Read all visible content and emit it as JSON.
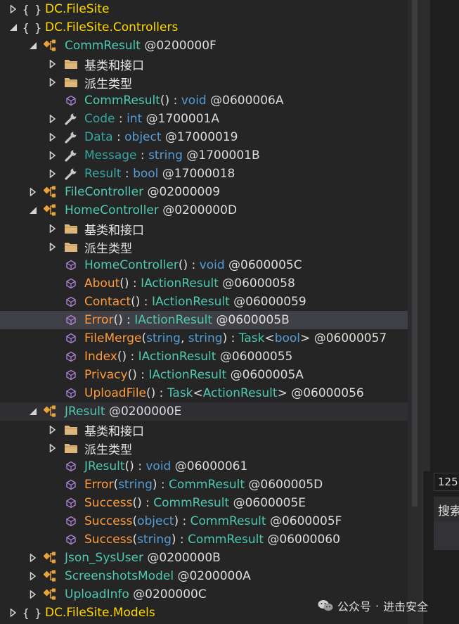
{
  "tree": {
    "rows": [
      {
        "indent": 0,
        "expander": "collapsed",
        "icon": "namespace",
        "parts": [
          {
            "t": "DC.FileSite",
            "c": "ns"
          }
        ]
      },
      {
        "indent": 0,
        "expander": "expanded",
        "icon": "namespace",
        "parts": [
          {
            "t": "DC.FileSite.Controllers",
            "c": "ns"
          }
        ]
      },
      {
        "indent": 1,
        "expander": "expanded",
        "icon": "class",
        "parts": [
          {
            "t": "CommResult",
            "c": "cls"
          },
          {
            "t": " @0200000F",
            "c": "token"
          }
        ]
      },
      {
        "indent": 2,
        "expander": "collapsed",
        "icon": "folder",
        "parts": [
          {
            "t": "基类和接口",
            "c": "folder-label"
          }
        ]
      },
      {
        "indent": 2,
        "expander": "collapsed",
        "icon": "folder",
        "parts": [
          {
            "t": "派生类型",
            "c": "folder-label"
          }
        ]
      },
      {
        "indent": 2,
        "expander": "none",
        "icon": "method",
        "parts": [
          {
            "t": "CommResult",
            "c": "method"
          },
          {
            "t": "() : ",
            "c": "punct"
          },
          {
            "t": "void",
            "c": "kw"
          },
          {
            "t": " @0600006A",
            "c": "token"
          }
        ]
      },
      {
        "indent": 2,
        "expander": "collapsed",
        "icon": "property",
        "parts": [
          {
            "t": "Code",
            "c": "prop"
          },
          {
            "t": " : ",
            "c": "punct"
          },
          {
            "t": "int",
            "c": "kw"
          },
          {
            "t": " @1700001A",
            "c": "token"
          }
        ]
      },
      {
        "indent": 2,
        "expander": "collapsed",
        "icon": "property",
        "parts": [
          {
            "t": "Data",
            "c": "prop"
          },
          {
            "t": " : ",
            "c": "punct"
          },
          {
            "t": "object",
            "c": "kw"
          },
          {
            "t": " @17000019",
            "c": "token"
          }
        ]
      },
      {
        "indent": 2,
        "expander": "collapsed",
        "icon": "property",
        "parts": [
          {
            "t": "Message",
            "c": "prop"
          },
          {
            "t": " : ",
            "c": "punct"
          },
          {
            "t": "string",
            "c": "kw"
          },
          {
            "t": " @1700001B",
            "c": "token"
          }
        ]
      },
      {
        "indent": 2,
        "expander": "collapsed",
        "icon": "property",
        "parts": [
          {
            "t": "Result",
            "c": "prop"
          },
          {
            "t": " : ",
            "c": "punct"
          },
          {
            "t": "bool",
            "c": "kw"
          },
          {
            "t": " @17000018",
            "c": "token"
          }
        ]
      },
      {
        "indent": 1,
        "expander": "collapsed",
        "icon": "class",
        "parts": [
          {
            "t": "FileController",
            "c": "cls"
          },
          {
            "t": " @02000009",
            "c": "token"
          }
        ]
      },
      {
        "indent": 1,
        "expander": "expanded",
        "icon": "class",
        "parts": [
          {
            "t": "HomeController",
            "c": "cls"
          },
          {
            "t": " @0200000D",
            "c": "token"
          }
        ]
      },
      {
        "indent": 2,
        "expander": "collapsed",
        "icon": "folder",
        "parts": [
          {
            "t": "基类和接口",
            "c": "folder-label"
          }
        ]
      },
      {
        "indent": 2,
        "expander": "collapsed",
        "icon": "folder",
        "parts": [
          {
            "t": "派生类型",
            "c": "folder-label"
          }
        ]
      },
      {
        "indent": 2,
        "expander": "none",
        "icon": "method",
        "parts": [
          {
            "t": "HomeController",
            "c": "method"
          },
          {
            "t": "() : ",
            "c": "punct"
          },
          {
            "t": "void",
            "c": "kw"
          },
          {
            "t": " @0600005C",
            "c": "token"
          }
        ]
      },
      {
        "indent": 2,
        "expander": "none",
        "icon": "method",
        "parts": [
          {
            "t": "About",
            "c": "method-private"
          },
          {
            "t": "() : ",
            "c": "punct"
          },
          {
            "t": "IActionResult",
            "c": "type"
          },
          {
            "t": " @06000058",
            "c": "token"
          }
        ]
      },
      {
        "indent": 2,
        "expander": "none",
        "icon": "method",
        "parts": [
          {
            "t": "Contact",
            "c": "method-private"
          },
          {
            "t": "() : ",
            "c": "punct"
          },
          {
            "t": "IActionResult",
            "c": "type"
          },
          {
            "t": " @06000059",
            "c": "token"
          }
        ]
      },
      {
        "indent": 2,
        "expander": "none",
        "icon": "method",
        "selected": true,
        "parts": [
          {
            "t": "Error",
            "c": "method-private"
          },
          {
            "t": "() : ",
            "c": "punct"
          },
          {
            "t": "IActionResult",
            "c": "type"
          },
          {
            "t": " @0600005B",
            "c": "token"
          }
        ]
      },
      {
        "indent": 2,
        "expander": "none",
        "icon": "method",
        "parts": [
          {
            "t": "FileMerge",
            "c": "method-private"
          },
          {
            "t": "(",
            "c": "punct"
          },
          {
            "t": "string",
            "c": "kw"
          },
          {
            "t": ", ",
            "c": "punct"
          },
          {
            "t": "string",
            "c": "kw"
          },
          {
            "t": ") : ",
            "c": "punct"
          },
          {
            "t": "Task",
            "c": "type"
          },
          {
            "t": "<",
            "c": "punct"
          },
          {
            "t": "bool",
            "c": "kw"
          },
          {
            "t": ">",
            "c": "punct"
          },
          {
            "t": " @06000057",
            "c": "token"
          }
        ]
      },
      {
        "indent": 2,
        "expander": "none",
        "icon": "method",
        "parts": [
          {
            "t": "Index",
            "c": "method-private"
          },
          {
            "t": "() : ",
            "c": "punct"
          },
          {
            "t": "IActionResult",
            "c": "type"
          },
          {
            "t": " @06000055",
            "c": "token"
          }
        ]
      },
      {
        "indent": 2,
        "expander": "none",
        "icon": "method",
        "parts": [
          {
            "t": "Privacy",
            "c": "method-private"
          },
          {
            "t": "() : ",
            "c": "punct"
          },
          {
            "t": "IActionResult",
            "c": "type"
          },
          {
            "t": " @0600005A",
            "c": "token"
          }
        ]
      },
      {
        "indent": 2,
        "expander": "none",
        "icon": "method",
        "parts": [
          {
            "t": "UploadFile",
            "c": "method-private"
          },
          {
            "t": "() : ",
            "c": "punct"
          },
          {
            "t": "Task",
            "c": "type"
          },
          {
            "t": "<",
            "c": "punct"
          },
          {
            "t": "ActionResult",
            "c": "type"
          },
          {
            "t": ">",
            "c": "punct"
          },
          {
            "t": " @06000056",
            "c": "token"
          }
        ]
      },
      {
        "indent": 1,
        "expander": "expanded",
        "icon": "class",
        "hover": true,
        "parts": [
          {
            "t": "JResult",
            "c": "cls"
          },
          {
            "t": " @0200000E",
            "c": "token"
          }
        ]
      },
      {
        "indent": 2,
        "expander": "collapsed",
        "icon": "folder",
        "parts": [
          {
            "t": "基类和接口",
            "c": "folder-label"
          }
        ]
      },
      {
        "indent": 2,
        "expander": "collapsed",
        "icon": "folder",
        "parts": [
          {
            "t": "派生类型",
            "c": "folder-label"
          }
        ]
      },
      {
        "indent": 2,
        "expander": "none",
        "icon": "method",
        "parts": [
          {
            "t": "JResult",
            "c": "method"
          },
          {
            "t": "() : ",
            "c": "punct"
          },
          {
            "t": "void",
            "c": "kw"
          },
          {
            "t": " @06000061",
            "c": "token"
          }
        ]
      },
      {
        "indent": 2,
        "expander": "none",
        "icon": "method",
        "parts": [
          {
            "t": "Error",
            "c": "method-private"
          },
          {
            "t": "(",
            "c": "punct"
          },
          {
            "t": "string",
            "c": "kw"
          },
          {
            "t": ") : ",
            "c": "punct"
          },
          {
            "t": "CommResult",
            "c": "type"
          },
          {
            "t": " @0600005D",
            "c": "token"
          }
        ]
      },
      {
        "indent": 2,
        "expander": "none",
        "icon": "method",
        "parts": [
          {
            "t": "Success",
            "c": "method-private"
          },
          {
            "t": "() : ",
            "c": "punct"
          },
          {
            "t": "CommResult",
            "c": "type"
          },
          {
            "t": " @0600005E",
            "c": "token"
          }
        ]
      },
      {
        "indent": 2,
        "expander": "none",
        "icon": "method",
        "parts": [
          {
            "t": "Success",
            "c": "method-private"
          },
          {
            "t": "(",
            "c": "punct"
          },
          {
            "t": "object",
            "c": "kw"
          },
          {
            "t": ") : ",
            "c": "punct"
          },
          {
            "t": "CommResult",
            "c": "type"
          },
          {
            "t": " @0600005F",
            "c": "token"
          }
        ]
      },
      {
        "indent": 2,
        "expander": "none",
        "icon": "method",
        "parts": [
          {
            "t": "Success",
            "c": "method-private"
          },
          {
            "t": "(",
            "c": "punct"
          },
          {
            "t": "string",
            "c": "kw"
          },
          {
            "t": ") : ",
            "c": "punct"
          },
          {
            "t": "CommResult",
            "c": "type"
          },
          {
            "t": " @06000060",
            "c": "token"
          }
        ]
      },
      {
        "indent": 1,
        "expander": "collapsed",
        "icon": "class",
        "parts": [
          {
            "t": "Json_SysUser",
            "c": "cls"
          },
          {
            "t": " @0200000B",
            "c": "token"
          }
        ]
      },
      {
        "indent": 1,
        "expander": "collapsed",
        "icon": "class",
        "parts": [
          {
            "t": "ScreenshotsModel",
            "c": "cls"
          },
          {
            "t": " @0200000A",
            "c": "token"
          }
        ]
      },
      {
        "indent": 1,
        "expander": "collapsed",
        "icon": "class",
        "parts": [
          {
            "t": "UploadInfo",
            "c": "cls"
          },
          {
            "t": " @0200000C",
            "c": "token"
          }
        ]
      },
      {
        "indent": 0,
        "expander": "collapsed",
        "icon": "namespace",
        "parts": [
          {
            "t": "DC.FileSite.Models",
            "c": "ns"
          }
        ]
      }
    ]
  },
  "namespace_glyph": "{ }",
  "right_pane": {
    "zoom_value": "125",
    "search_label": "搜索"
  },
  "watermark": {
    "brand": "公众号",
    "separator": "·",
    "name": "进击安全"
  },
  "colors": {
    "namespace": "#ffd700",
    "class": "#4ec9b0",
    "method_private": "#ff9a3d",
    "keyword": "#569cd6",
    "property": "#37a6a0",
    "selection": "#3f3f46"
  }
}
